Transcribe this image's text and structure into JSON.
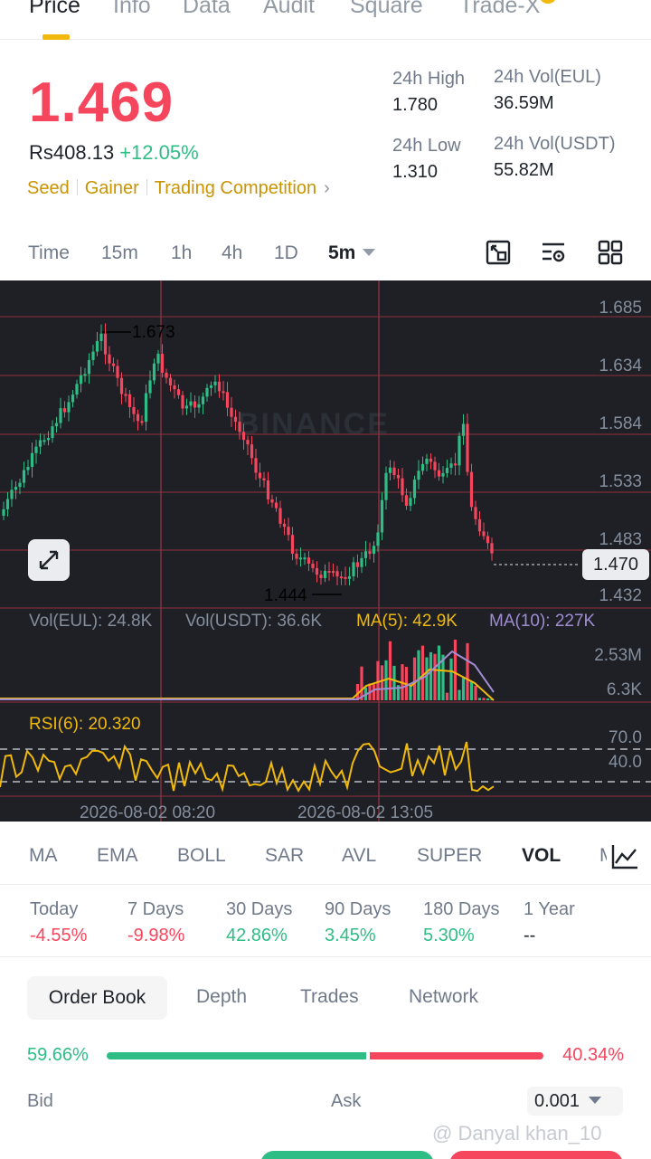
{
  "top_tabs": [
    "Price",
    "Info",
    "Data",
    "Audit",
    "Square",
    "Trade-X"
  ],
  "price": {
    "last": "1.469",
    "fiat": "Rs408.13",
    "change": "+12.05%",
    "tags": [
      "Seed",
      "Gainer",
      "Trading Competition"
    ],
    "stats": {
      "high_label": "24h High",
      "high": "1.780",
      "low_label": "24h Low",
      "low": "1.310",
      "vol_eul_label": "24h Vol(EUL)",
      "vol_eul": "36.59M",
      "vol_usdt_label": "24h Vol(USDT)",
      "vol_usdt": "55.82M"
    }
  },
  "intervals": [
    "Time",
    "15m",
    "1h",
    "4h",
    "1D",
    "5m"
  ],
  "tool_icons": [
    "fullscreen-icon",
    "chart-settings-icon",
    "grid-layout-icon"
  ],
  "chart": {
    "watermark": "BINANCE",
    "price_axis": [
      "1.685",
      "1.634",
      "1.584",
      "1.533",
      "1.483",
      "1.432"
    ],
    "high_marker": "1.673",
    "low_marker": "1.444",
    "current_price": "1.470",
    "volume": {
      "vol_eul": "Vol(EUL): 24.8K",
      "vol_usdt": "Vol(USDT): 36.6K",
      "ma5": "MA(5): 42.9K",
      "ma10": "MA(10): 227K",
      "axis": [
        "2.53M",
        "6.3K"
      ]
    },
    "rsi": {
      "label": "RSI(6): 20.320",
      "levels": [
        "70.0",
        "40.0"
      ]
    },
    "time_axis": [
      "2026-08-02 08:20",
      "2026-08-02 13:05"
    ],
    "colors": {
      "up": "#2ebd85",
      "down": "#f6465d",
      "ma5": "#f0b90b",
      "ma10": "#a18cd1",
      "bg": "#1e2026"
    }
  },
  "indicators": [
    "MA",
    "EMA",
    "BOLL",
    "SAR",
    "AVL",
    "SUPER",
    "VOL",
    "M"
  ],
  "performance": [
    {
      "label": "Today",
      "value": "-4.55%"
    },
    {
      "label": "7 Days",
      "value": "-9.98%"
    },
    {
      "label": "30 Days",
      "value": "42.86%"
    },
    {
      "label": "90 Days",
      "value": "3.45%"
    },
    {
      "label": "180 Days",
      "value": "5.30%"
    },
    {
      "label": "1 Year",
      "value": "--"
    }
  ],
  "order_book": {
    "tabs": [
      "Order Book",
      "Depth",
      "Trades",
      "Network"
    ],
    "bid_ratio": "59.66%",
    "ask_ratio": "40.34%",
    "bid_label": "Bid",
    "ask_label": "Ask",
    "step": "0.001"
  },
  "credit": "@ Danyal khan_10"
}
